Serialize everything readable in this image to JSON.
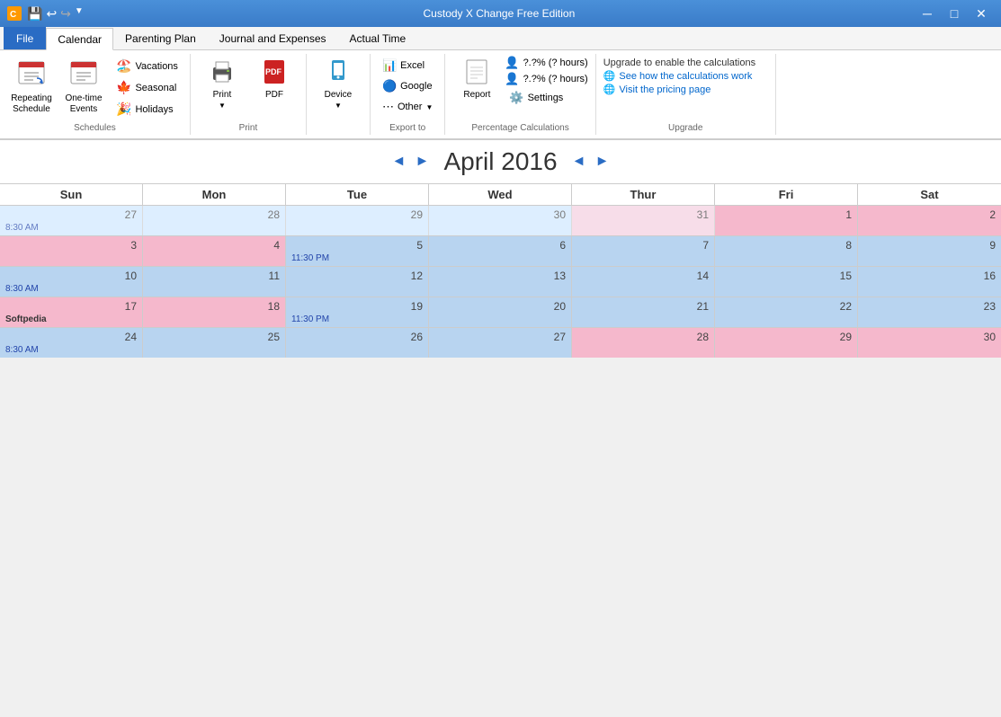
{
  "app": {
    "title": "Custody X Change Free Edition"
  },
  "titlebar": {
    "min_label": "─",
    "max_label": "□",
    "close_label": "✕"
  },
  "quickaccess": {
    "icons": [
      "💾",
      "↩",
      "↪"
    ]
  },
  "tabs": {
    "file_label": "File",
    "items": [
      {
        "label": "Calendar",
        "active": true
      },
      {
        "label": "Parenting Plan"
      },
      {
        "label": "Journal and Expenses"
      },
      {
        "label": "Actual Time"
      }
    ]
  },
  "ribbon": {
    "schedules_group": {
      "label": "Schedules",
      "repeating": {
        "label": "Repeating\nSchedule"
      },
      "onetime": {
        "label": "One-time\nEvents"
      },
      "items": [
        {
          "label": "Vacations"
        },
        {
          "label": "Seasonal"
        },
        {
          "label": "Holidays"
        }
      ]
    },
    "print_group": {
      "label": "Print",
      "print": {
        "label": "Print"
      },
      "pdf": {
        "label": "PDF"
      }
    },
    "device_group": {
      "label": "",
      "device": {
        "label": "Device"
      }
    },
    "export_group": {
      "label": "Export to",
      "items": [
        {
          "label": "Excel"
        },
        {
          "label": "Google"
        },
        {
          "label": "Other"
        }
      ]
    },
    "report_group": {
      "label": "",
      "report": {
        "label": "Report"
      },
      "items": [
        {
          "label": "?.?% (? hours)"
        },
        {
          "label": "?.?% (? hours)"
        }
      ],
      "settings": {
        "label": "Settings"
      }
    },
    "pct_group_label": "Percentage Calculations",
    "upgrade_group": {
      "label": "Upgrade",
      "text": "Upgrade to enable the calculations",
      "see_how": "See how the calculations work",
      "visit": "Visit the pricing page",
      "upgrade": "Upgrade"
    }
  },
  "calendar": {
    "month": "April 2016",
    "prev_month": "◄",
    "next_month": "►",
    "prev_year": "◄",
    "next_year": "►",
    "headers": [
      "Sun",
      "Mon",
      "Tue",
      "Wed",
      "Thur",
      "Fri",
      "Sat"
    ],
    "weeks": [
      [
        {
          "num": "27",
          "color": "blue",
          "other": true,
          "time": "8:30 AM",
          "event": ""
        },
        {
          "num": "28",
          "color": "blue",
          "other": true,
          "event": ""
        },
        {
          "num": "29",
          "color": "blue",
          "other": true,
          "event": ""
        },
        {
          "num": "30",
          "color": "blue",
          "other": true,
          "event": ""
        },
        {
          "num": "31",
          "color": "pink",
          "other": true,
          "event": ""
        },
        {
          "num": "1",
          "color": "pink",
          "event": ""
        },
        {
          "num": "2",
          "color": "pink",
          "event": ""
        }
      ],
      [
        {
          "num": "3",
          "color": "pink",
          "event": ""
        },
        {
          "num": "4",
          "color": "pink",
          "event": ""
        },
        {
          "num": "5",
          "color": "blue",
          "event": "",
          "time": "11:30 PM"
        },
        {
          "num": "6",
          "color": "blue",
          "event": ""
        },
        {
          "num": "7",
          "color": "blue",
          "event": ""
        },
        {
          "num": "8",
          "color": "blue",
          "event": ""
        },
        {
          "num": "9",
          "color": "blue",
          "event": ""
        }
      ],
      [
        {
          "num": "10",
          "color": "blue",
          "event": "",
          "time": "8:30 AM"
        },
        {
          "num": "11",
          "color": "blue",
          "event": ""
        },
        {
          "num": "12",
          "color": "blue",
          "event": ""
        },
        {
          "num": "13",
          "color": "blue",
          "event": ""
        },
        {
          "num": "14",
          "color": "blue",
          "event": ""
        },
        {
          "num": "15",
          "color": "blue",
          "event": ""
        },
        {
          "num": "16",
          "color": "blue",
          "event": ""
        }
      ],
      [
        {
          "num": "17",
          "color": "pink",
          "event": "Softpedia"
        },
        {
          "num": "18",
          "color": "pink",
          "event": ""
        },
        {
          "num": "19",
          "color": "blue",
          "event": "",
          "time": "11:30 PM"
        },
        {
          "num": "20",
          "color": "blue",
          "event": ""
        },
        {
          "num": "21",
          "color": "blue",
          "event": ""
        },
        {
          "num": "22",
          "color": "blue",
          "event": ""
        },
        {
          "num": "23",
          "color": "blue",
          "event": ""
        }
      ],
      [
        {
          "num": "24",
          "color": "blue",
          "event": "",
          "time": "8:30 AM"
        },
        {
          "num": "25",
          "color": "blue",
          "event": ""
        },
        {
          "num": "26",
          "color": "blue",
          "event": ""
        },
        {
          "num": "27",
          "color": "blue",
          "event": ""
        },
        {
          "num": "28",
          "color": "pink",
          "event": ""
        },
        {
          "num": "29",
          "color": "pink",
          "event": ""
        },
        {
          "num": "30",
          "color": "pink",
          "event": ""
        }
      ]
    ],
    "softpedia_label": "Softpedia"
  }
}
